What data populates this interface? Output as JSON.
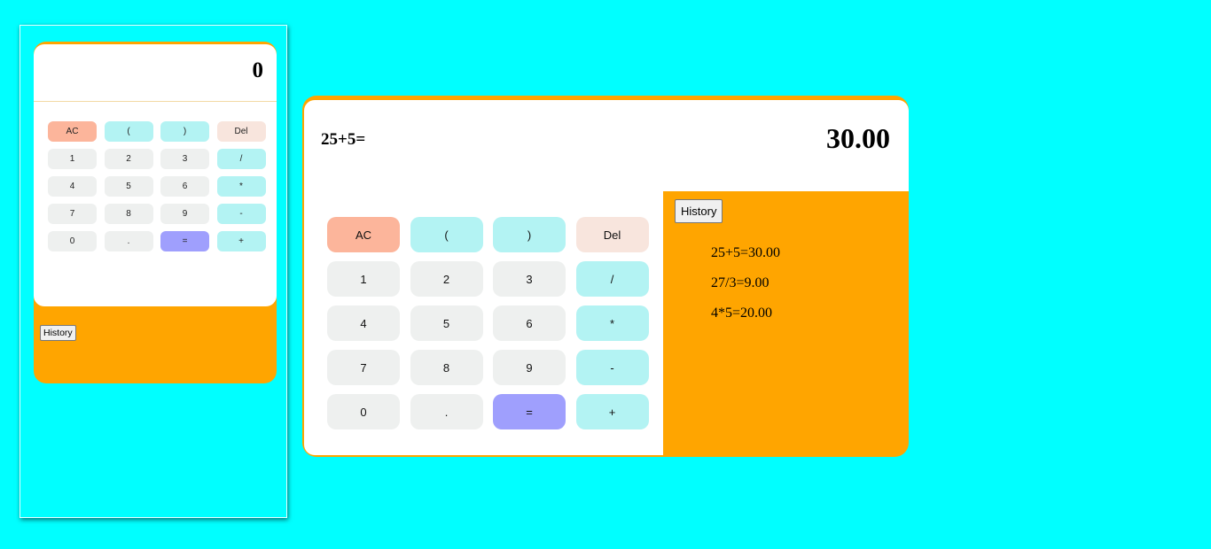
{
  "mobile": {
    "result": "0",
    "history_button": "History",
    "keys": [
      {
        "label": "AC",
        "name": "ac",
        "color": "#fcb59b"
      },
      {
        "label": "(",
        "name": "open-paren",
        "color": "#b3f3f3"
      },
      {
        "label": ")",
        "name": "close-paren",
        "color": "#b3f3f3"
      },
      {
        "label": "Del",
        "name": "del",
        "color": "#f8e5dd"
      },
      {
        "label": "1",
        "name": "1",
        "color": "#eef0ef"
      },
      {
        "label": "2",
        "name": "2",
        "color": "#eef0ef"
      },
      {
        "label": "3",
        "name": "3",
        "color": "#eef0ef"
      },
      {
        "label": "/",
        "name": "divide",
        "color": "#b3f3f3"
      },
      {
        "label": "4",
        "name": "4",
        "color": "#eef0ef"
      },
      {
        "label": "5",
        "name": "5",
        "color": "#eef0ef"
      },
      {
        "label": "6",
        "name": "6",
        "color": "#eef0ef"
      },
      {
        "label": "*",
        "name": "multiply",
        "color": "#b3f3f3"
      },
      {
        "label": "7",
        "name": "7",
        "color": "#eef0ef"
      },
      {
        "label": "8",
        "name": "8",
        "color": "#eef0ef"
      },
      {
        "label": "9",
        "name": "9",
        "color": "#eef0ef"
      },
      {
        "label": "-",
        "name": "minus",
        "color": "#b3f3f3"
      },
      {
        "label": "0",
        "name": "0",
        "color": "#eef0ef"
      },
      {
        "label": ".",
        "name": "decimal",
        "color": "#eef0ef"
      },
      {
        "label": "=",
        "name": "equals",
        "color": "#9f9ffd"
      },
      {
        "label": "+",
        "name": "plus",
        "color": "#b3f3f3"
      }
    ]
  },
  "calculator": {
    "expression": "25+5=",
    "result": "30.00",
    "history_button": "History",
    "history": [
      "25+5=30.00",
      "27/3=9.00",
      "4*5=20.00"
    ],
    "keys": [
      {
        "label": "AC",
        "name": "ac",
        "kind": "ac"
      },
      {
        "label": "(",
        "name": "open-paren",
        "kind": "op"
      },
      {
        "label": ")",
        "name": "close-paren",
        "kind": "op"
      },
      {
        "label": "Del",
        "name": "del",
        "kind": "del"
      },
      {
        "label": "1",
        "name": "1",
        "kind": "num"
      },
      {
        "label": "2",
        "name": "2",
        "kind": "num"
      },
      {
        "label": "3",
        "name": "3",
        "kind": "num"
      },
      {
        "label": "/",
        "name": "divide",
        "kind": "op"
      },
      {
        "label": "4",
        "name": "4",
        "kind": "num"
      },
      {
        "label": "5",
        "name": "5",
        "kind": "num"
      },
      {
        "label": "6",
        "name": "6",
        "kind": "num"
      },
      {
        "label": "*",
        "name": "multiply",
        "kind": "op"
      },
      {
        "label": "7",
        "name": "7",
        "kind": "num"
      },
      {
        "label": "8",
        "name": "8",
        "kind": "num"
      },
      {
        "label": "9",
        "name": "9",
        "kind": "num"
      },
      {
        "label": "-",
        "name": "minus",
        "kind": "op"
      },
      {
        "label": "0",
        "name": "0",
        "kind": "num"
      },
      {
        "label": ".",
        "name": "decimal",
        "kind": "num"
      },
      {
        "label": "=",
        "name": "equals",
        "kind": "eq"
      },
      {
        "label": "+",
        "name": "plus",
        "kind": "op"
      }
    ]
  },
  "colors": {
    "background": "#00ffff",
    "frame": "#ffa500",
    "operator_key": "#b3f3f3",
    "number_key": "#eef0ef",
    "ac_key": "#fcb59b",
    "del_key": "#f8e5dd",
    "equals_key": "#9f9ffd"
  }
}
